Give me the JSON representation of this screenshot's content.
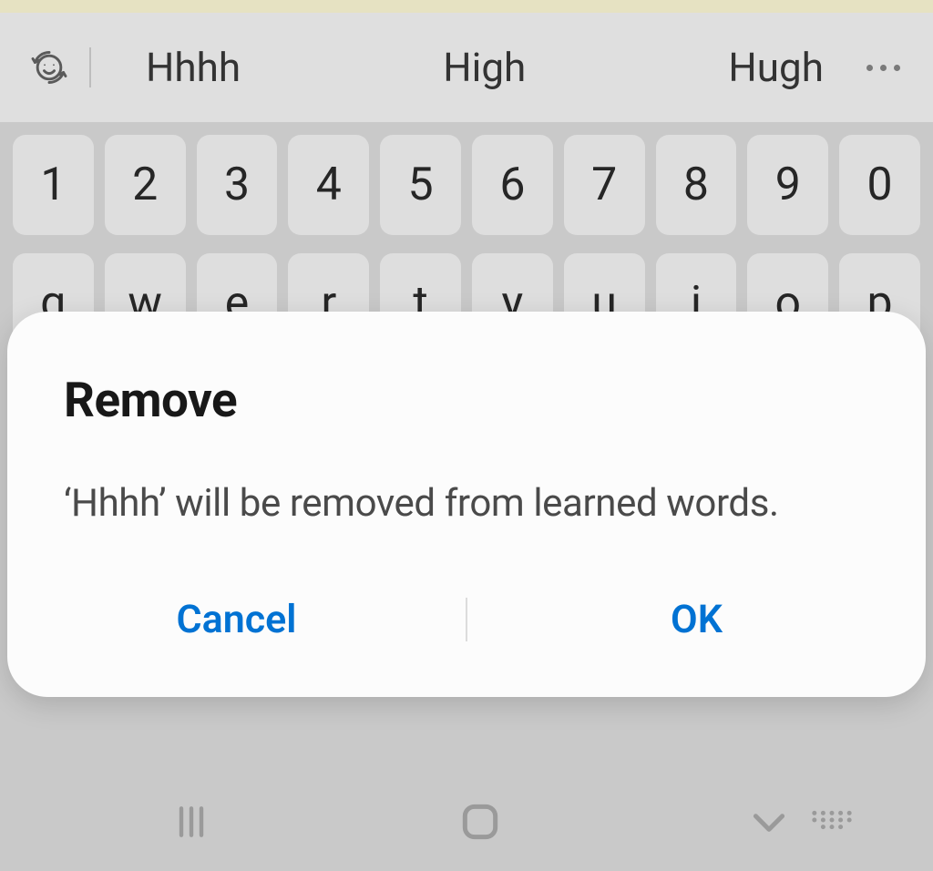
{
  "suggestions": {
    "s1": "Hhhh",
    "s2": "High",
    "s3": "Hugh"
  },
  "keys": {
    "r1": {
      "k0": "1",
      "k1": "2",
      "k2": "3",
      "k3": "4",
      "k4": "5",
      "k5": "6",
      "k6": "7",
      "k7": "8",
      "k8": "9",
      "k9": "0"
    },
    "r2": {
      "k0": "q",
      "k1": "w",
      "k2": "e",
      "k3": "r",
      "k4": "t",
      "k5": "y",
      "k6": "u",
      "k7": "i",
      "k8": "o",
      "k9": "p"
    }
  },
  "dialog": {
    "title": "Remove",
    "body": "‘Hhhh’ will be removed from learned words.",
    "cancel": "Cancel",
    "ok": "OK"
  }
}
